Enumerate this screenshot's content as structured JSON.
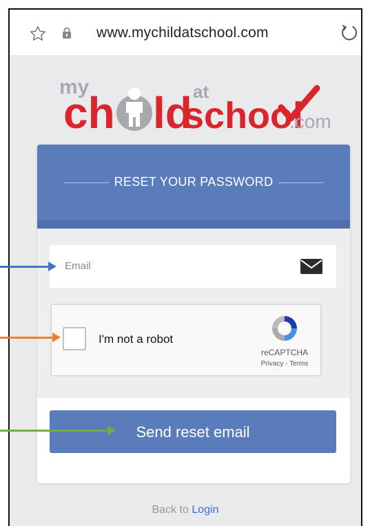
{
  "browser": {
    "url": "www.mychildatschool.com",
    "icons": {
      "favorite": "star-icon",
      "secure": "lock-icon",
      "reload": "reload-icon"
    }
  },
  "logo": {
    "my": "my",
    "chi": "ch",
    "ld": "ld",
    "at": "at",
    "school": "school",
    "com": ".com",
    "colors": {
      "red": "#d8262c",
      "grey": "#a7a9ac"
    }
  },
  "reset": {
    "title": "RESET YOUR PASSWORD",
    "email_placeholder": "Email",
    "email_icon": "envelope-icon",
    "captcha": {
      "label": "I'm not a robot",
      "brand": "reCAPTCHA",
      "links": "Privacy - Terms"
    },
    "submit_label": "Send reset email"
  },
  "footer": {
    "back_text": "Back to ",
    "login_link": "Login"
  },
  "annotations": {
    "arrow_colors": [
      "#4472c4",
      "#ed7d31",
      "#70ad47"
    ]
  },
  "colors": {
    "primary": "#5b7cba",
    "link": "#3a6fc2",
    "background": "#e9eaec"
  }
}
